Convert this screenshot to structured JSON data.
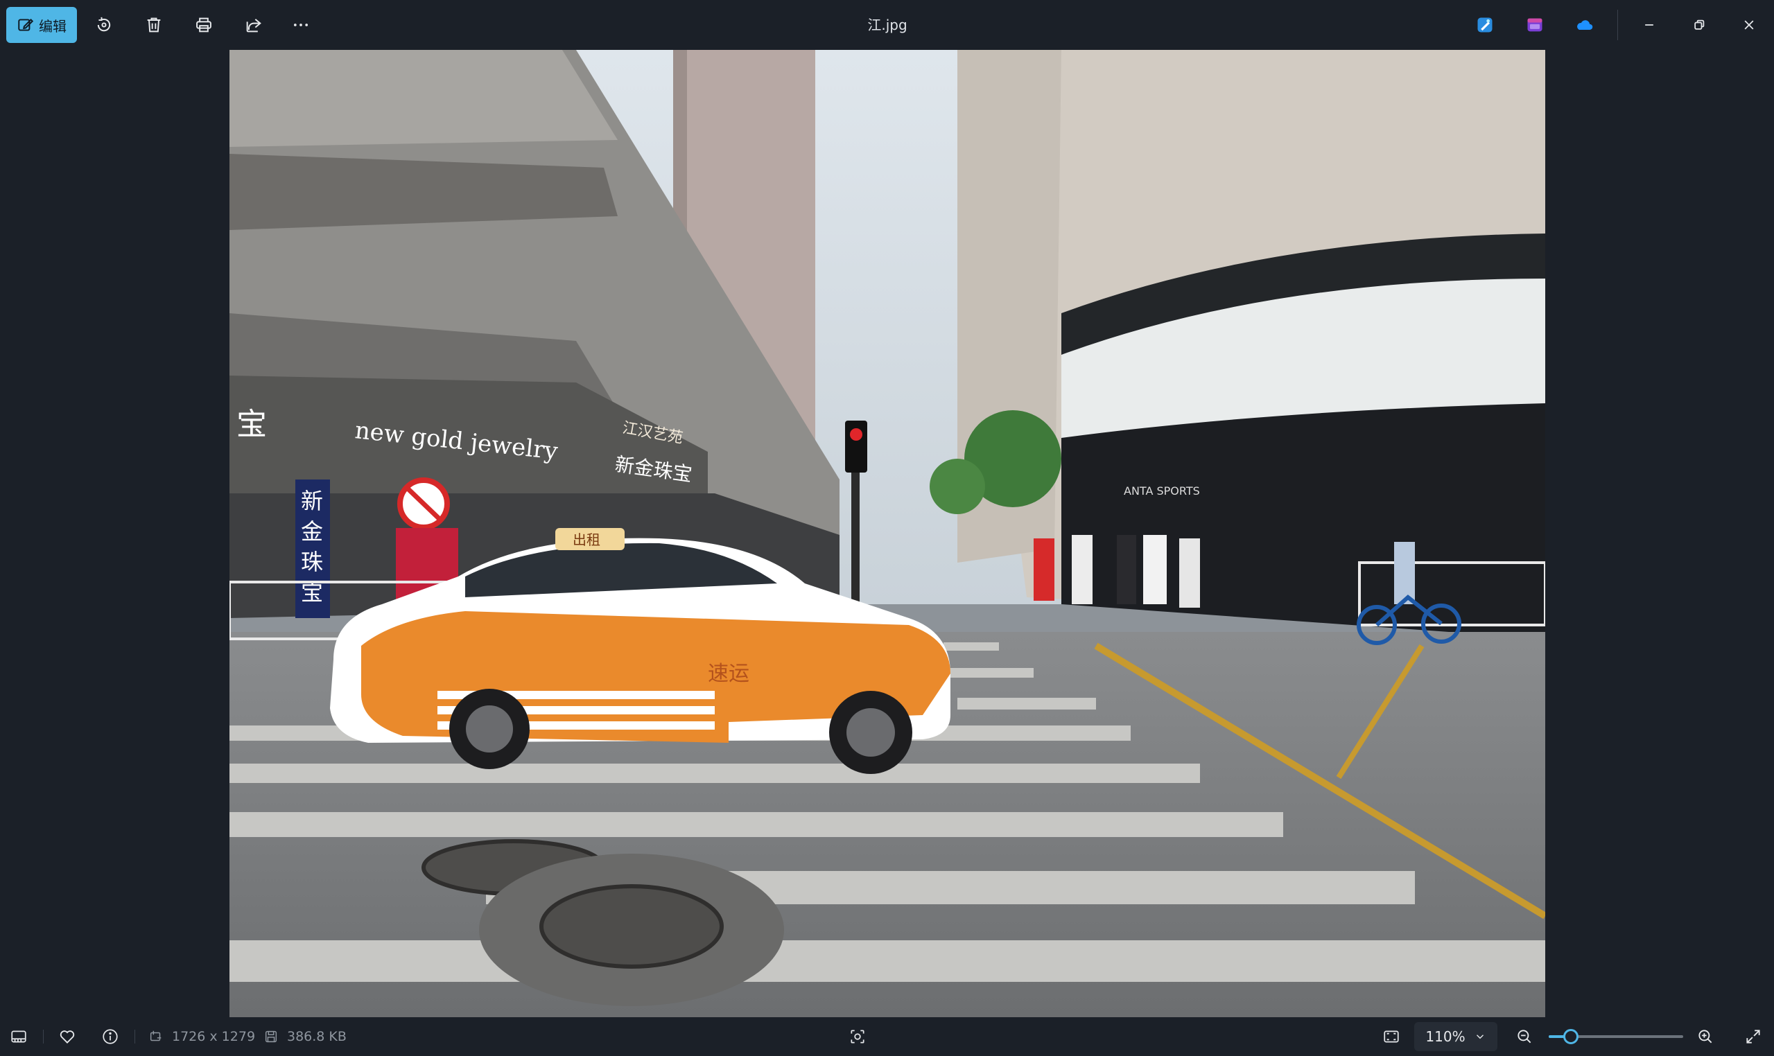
{
  "app": {
    "file_name": "江.jpg"
  },
  "toolbar": {
    "edit_label": "编辑",
    "icons": [
      "edit-icon",
      "rotate-icon",
      "delete-icon",
      "print-icon",
      "share-icon",
      "more-icon"
    ],
    "app_icons": [
      "designer-app-icon",
      "clipchamp-app-icon",
      "onedrive-icon"
    ],
    "window_controls": [
      "minimize-icon",
      "restore-icon",
      "close-icon"
    ]
  },
  "bottom_bar": {
    "dimensions": "1726 x 1279",
    "file_size": "386.8 KB",
    "zoom_label": "110%",
    "zoom_level_fraction": 0.12
  },
  "photo": {
    "scene_text": {
      "sign_new_gold": "new gold jewelry",
      "sign_bao": "宝",
      "sign_xinjinzhubao": "新金珠宝",
      "sign_vertical": [
        "新",
        "金",
        "珠",
        "宝"
      ],
      "sign_jianghan": "江汉艺苑",
      "taxi_text": "速运",
      "taxi_roof": "出租",
      "store_brand": "ANTA SPORTS"
    }
  },
  "colors": {
    "accent": "#4fb6e6",
    "background": "#1b2028",
    "taxi_orange": "#ea8a2c"
  }
}
